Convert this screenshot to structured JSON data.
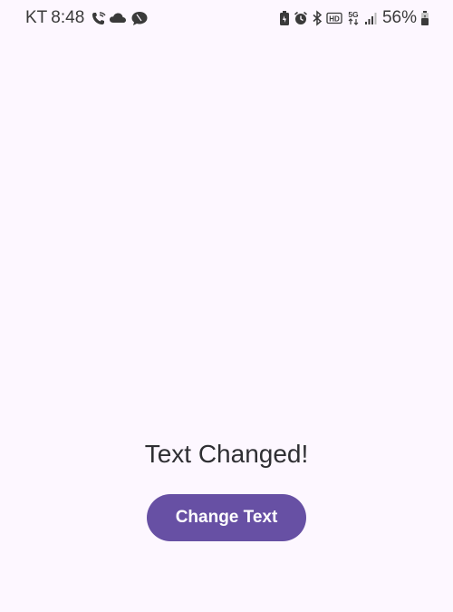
{
  "status_bar": {
    "carrier": "KT",
    "time": "8:48",
    "left_icons": [
      "wifi-calling-icon",
      "cloud-icon",
      "chat-bubble-icon"
    ],
    "right_icons": [
      "battery-saver-icon",
      "alarm-icon",
      "bluetooth-icon",
      "hd-icon",
      "5g-icon",
      "signal-icon"
    ],
    "battery_percent": "56%",
    "network_label": "5G",
    "hd_label": "HD"
  },
  "main": {
    "text": "Text Changed!",
    "button_label": "Change Text"
  },
  "colors": {
    "background": "#fdf7ff",
    "button": "#6750a4",
    "button_text": "#ffffff",
    "text": "#2f2f33"
  }
}
